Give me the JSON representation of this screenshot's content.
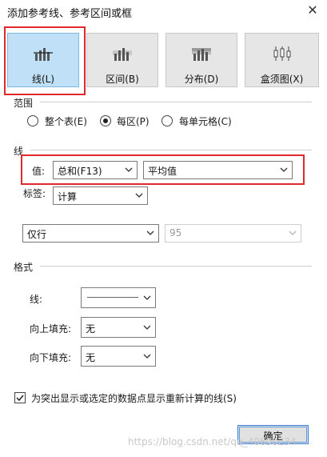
{
  "dialog": {
    "title": "添加参考线、参考区间或框",
    "close_glyph": "✕"
  },
  "types": [
    {
      "label": "线(L)",
      "icon": "line-icon",
      "active": true
    },
    {
      "label": "区间(B)",
      "icon": "band-icon",
      "active": false
    },
    {
      "label": "分布(D)",
      "icon": "distribution-icon",
      "active": false
    },
    {
      "label": "盒须图(X)",
      "icon": "boxplot-icon",
      "active": false
    }
  ],
  "scope": {
    "heading": "范围",
    "options": [
      {
        "label": "整个表(E)",
        "selected": false
      },
      {
        "label": "每区(P)",
        "selected": true
      },
      {
        "label": "每单元格(C)",
        "selected": false
      }
    ]
  },
  "line": {
    "heading": "线",
    "value_label": "值:",
    "value_field": "总和(F13)",
    "aggregation": "平均值",
    "tag_label": "标签:",
    "tag_value": "计算",
    "tooltip_value": "仅行",
    "percent_value": "95"
  },
  "format": {
    "heading": "格式",
    "line_label": "线:",
    "fill_above_label": "向上填充:",
    "fill_above_value": "无",
    "fill_below_label": "向下填充:",
    "fill_below_value": "无"
  },
  "recalc": {
    "label": "为突出显示或选定的数据点显示重新计算的线(S)",
    "checked": true
  },
  "ok_label": "确定",
  "watermark": "https://blog.csdn.net/qq_40690234",
  "colors": {
    "highlight_border": "#e12b2b",
    "active_tile": "#bfe0f7",
    "ok_border": "#3c7fd8"
  }
}
